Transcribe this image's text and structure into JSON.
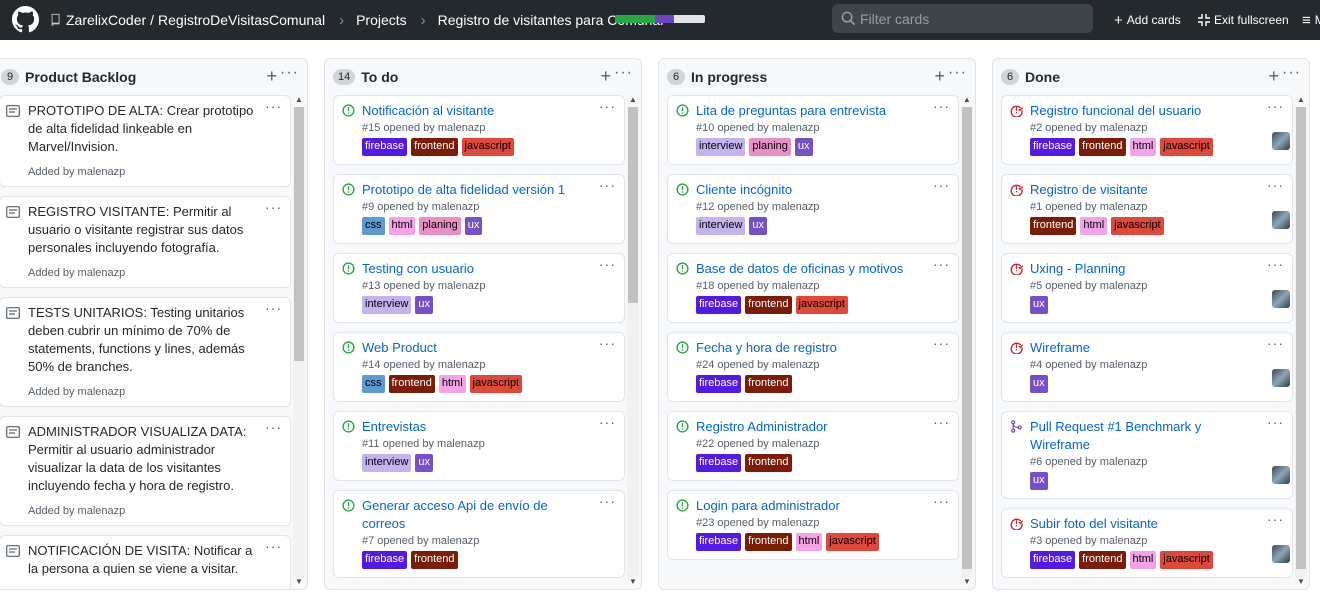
{
  "header": {
    "owner": "ZarelixCoder",
    "slash": "/",
    "repo": "RegistroDeVisitasComunal",
    "projects": "Projects",
    "project_title": "Registro de visitantes para Comunal",
    "progress": {
      "done_pct": 44,
      "in_progress_pct": 22,
      "colors": {
        "done": "#28a745",
        "in_progress": "#6f42c1",
        "todo": "#e1e4e8"
      }
    },
    "filter_placeholder": "Filter cards",
    "add_cards": "Add cards",
    "exit_fullscreen": "Exit fullscreen",
    "menu_partial": "M"
  },
  "label_colors": {
    "firebase": {
      "bg": "#5319e7",
      "fg": "#ffffff"
    },
    "frontend": {
      "bg": "#7a1c06",
      "fg": "#ffffff"
    },
    "javascript": {
      "bg": "#e0483a",
      "fg": "#000000"
    },
    "css": {
      "bg": "#5c9ad1",
      "fg": "#000000"
    },
    "html": {
      "bg": "#f5a3e8",
      "fg": "#000000"
    },
    "planing": {
      "bg": "#ea8fc4",
      "fg": "#000000"
    },
    "ux": {
      "bg": "#7650c9",
      "fg": "#ffffff"
    },
    "interview": {
      "bg": "#c5b3ee",
      "fg": "#000000"
    }
  },
  "columns": [
    {
      "count": "9",
      "title": "Product Backlog",
      "cards": [
        {
          "type": "note",
          "text": "PROTOTIPO DE ALTA: Crear prototipo de alta fidelidad linkeable en Marvel/Invision.",
          "added": "Added by malenazp"
        },
        {
          "type": "note",
          "text": "REGISTRO VISITANTE: Permitir al usuario o visitante registrar sus datos personales incluyendo fotografía.",
          "added": "Added by malenazp"
        },
        {
          "type": "note",
          "text": "TESTS UNITARIOS: Testing unitarios deben cubrir un mínimo de 70% de statements, functions y lines, además 50% de branches.",
          "added": "Added by malenazp"
        },
        {
          "type": "note",
          "text": "ADMINISTRADOR VISUALIZA DATA: Permitir al usuario administrador visualizar la data de los visitantes incluyendo fecha y hora de registro.",
          "added": "Added by malenazp"
        },
        {
          "type": "note",
          "text": "NOTIFICACIÓN DE VISITA: Notificar a la persona a quien se viene a visitar.",
          "added": "Added by malenazp"
        }
      ]
    },
    {
      "count": "14",
      "title": "To do",
      "cards": [
        {
          "type": "issue",
          "state": "open",
          "title": "Notificación al visitante",
          "meta": "#15 opened by malenazp",
          "labels": [
            "firebase",
            "frontend",
            "javascript"
          ]
        },
        {
          "type": "issue",
          "state": "open",
          "title": "Prototipo de alta fidelidad versión 1",
          "meta": "#9 opened by malenazp",
          "labels": [
            "css",
            "html",
            "planing",
            "ux"
          ]
        },
        {
          "type": "issue",
          "state": "open",
          "title": "Testing con usuario",
          "meta": "#13 opened by malenazp",
          "labels": [
            "interview",
            "ux"
          ]
        },
        {
          "type": "issue",
          "state": "open",
          "title": "Web Product",
          "meta": "#14 opened by malenazp",
          "labels": [
            "css",
            "frontend",
            "html",
            "javascript"
          ]
        },
        {
          "type": "issue",
          "state": "open",
          "title": "Entrevistas",
          "meta": "#11 opened by malenazp",
          "labels": [
            "interview",
            "ux"
          ]
        },
        {
          "type": "issue",
          "state": "open",
          "title": "Generar acceso Api de envío de correos",
          "meta": "#7 opened by malenazp",
          "labels": [
            "firebase",
            "frontend"
          ]
        }
      ]
    },
    {
      "count": "6",
      "title": "In progress",
      "cards": [
        {
          "type": "issue",
          "state": "open",
          "title": "Lita de preguntas para entrevista",
          "meta": "#10 opened by malenazp",
          "labels": [
            "interview",
            "planing",
            "ux"
          ]
        },
        {
          "type": "issue",
          "state": "open",
          "title": "Cliente incógnito",
          "meta": "#12 opened by malenazp",
          "labels": [
            "interview",
            "ux"
          ]
        },
        {
          "type": "issue",
          "state": "open",
          "title": "Base de datos de oficinas y motivos",
          "meta": "#18 opened by malenazp",
          "labels": [
            "firebase",
            "frontend",
            "javascript"
          ]
        },
        {
          "type": "issue",
          "state": "open",
          "title": "Fecha y hora de registro",
          "meta": "#24 opened by malenazp",
          "labels": [
            "firebase",
            "frontend"
          ]
        },
        {
          "type": "issue",
          "state": "open",
          "title": "Registro Administrador",
          "meta": "#22 opened by malenazp",
          "labels": [
            "firebase",
            "frontend"
          ]
        },
        {
          "type": "issue",
          "state": "open",
          "title": "Login para administrador",
          "meta": "#23 opened by malenazp",
          "labels": [
            "firebase",
            "frontend",
            "html",
            "javascript"
          ]
        }
      ]
    },
    {
      "count": "6",
      "title": "Done",
      "cards": [
        {
          "type": "issue",
          "state": "closed",
          "title": "Registro funcional del usuario",
          "meta": "#2 opened by malenazp",
          "labels": [
            "firebase",
            "frontend",
            "html",
            "javascript"
          ],
          "avatar": true
        },
        {
          "type": "issue",
          "state": "closed",
          "title": "Registro de visitante",
          "meta": "#1 opened by malenazp",
          "labels": [
            "frontend",
            "html",
            "javascript"
          ],
          "avatar": true
        },
        {
          "type": "issue",
          "state": "closed",
          "title": "Uxing - Planning",
          "meta": "#5 opened by malenazp",
          "labels": [
            "ux"
          ],
          "avatar": true
        },
        {
          "type": "issue",
          "state": "closed",
          "title": "Wireframe",
          "meta": "#4 opened by malenazp",
          "labels": [
            "ux"
          ],
          "avatar": true
        },
        {
          "type": "issue",
          "state": "merged",
          "title": "Pull Request #1 Benchmark y Wireframe",
          "meta": "#6 opened by malenazp",
          "labels": [
            "ux"
          ],
          "avatar": true
        },
        {
          "type": "issue",
          "state": "closed",
          "title": "Subir foto del visitante",
          "meta": "#3 opened by malenazp",
          "labels": [
            "firebase",
            "frontend",
            "html",
            "javascript"
          ],
          "avatar": true
        }
      ]
    }
  ]
}
